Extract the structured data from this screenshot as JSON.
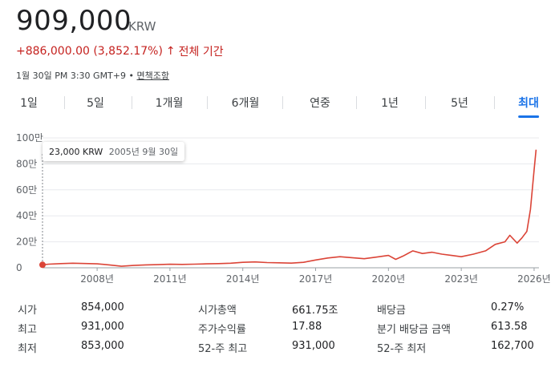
{
  "header": {
    "price": "909,000",
    "currency": "KRW",
    "change": "+886,000.00 (3,852.17%)",
    "change_arrow": "↑",
    "change_period": "전체 기간",
    "timestamp": "1월 30일 PM 3:30 GMT+9 •",
    "disclaimer": "면책조항",
    "accent_color": "#c5221f"
  },
  "tabs": [
    "1일",
    "5일",
    "1개월",
    "6개월",
    "연중",
    "1년",
    "5년",
    "최대"
  ],
  "active_tab": "최대",
  "tooltip": {
    "value": "23,000 KRW",
    "date": "2005년 9월 30일"
  },
  "chart_data": {
    "type": "line",
    "title": "",
    "xlabel": "",
    "ylabel": "",
    "y_tick_labels": [
      "0",
      "20만",
      "40만",
      "60만",
      "80만",
      "100만"
    ],
    "y_ticks": [
      0,
      200000,
      400000,
      600000,
      800000,
      1000000
    ],
    "x_tick_labels": [
      "2008년",
      "2011년",
      "2014년",
      "2017년",
      "2020년",
      "2023년",
      "2026년"
    ],
    "x_ticks": [
      2008,
      2011,
      2014,
      2017,
      2020,
      2023,
      2026
    ],
    "xlim": [
      2005.75,
      2026.2
    ],
    "ylim": [
      0,
      1000000
    ],
    "line_color": "#db4437",
    "series": [
      {
        "x": [
          2005.75,
          2006.0,
          2006.5,
          2007.0,
          2007.5,
          2008.0,
          2008.5,
          2009.0,
          2009.5,
          2010.0,
          2010.5,
          2011.0,
          2011.5,
          2012.0,
          2012.5,
          2013.0,
          2013.5,
          2014.0,
          2014.5,
          2015.0,
          2015.5,
          2016.0,
          2016.5,
          2017.0,
          2017.5,
          2018.0,
          2018.5,
          2019.0,
          2019.5,
          2020.0,
          2020.3,
          2020.6,
          2021.0,
          2021.4,
          2021.8,
          2022.2,
          2022.6,
          2023.0,
          2023.5,
          2024.0,
          2024.4,
          2024.8,
          2025.0,
          2025.3,
          2025.5,
          2025.7,
          2025.85,
          2026.0,
          2026.08
        ],
        "y": [
          23000,
          28000,
          32000,
          35000,
          33000,
          30000,
          22000,
          12000,
          18000,
          22000,
          24000,
          27000,
          26000,
          28000,
          30000,
          32000,
          35000,
          42000,
          45000,
          40000,
          38000,
          36000,
          42000,
          60000,
          75000,
          85000,
          78000,
          70000,
          82000,
          95000,
          65000,
          90000,
          130000,
          110000,
          120000,
          105000,
          95000,
          85000,
          105000,
          130000,
          180000,
          200000,
          250000,
          190000,
          230000,
          280000,
          450000,
          750000,
          909000
        ]
      }
    ]
  },
  "stats": [
    [
      {
        "label": "시가",
        "value": "854,000"
      },
      {
        "label": "시가총액",
        "value": "661.75조"
      },
      {
        "label": "배당금",
        "value": "0.27%"
      }
    ],
    [
      {
        "label": "최고",
        "value": "931,000"
      },
      {
        "label": "주가수익률",
        "value": "17.88"
      },
      {
        "label": "분기 배당금 금액",
        "value": "613.58"
      }
    ],
    [
      {
        "label": "최저",
        "value": "853,000"
      },
      {
        "label": "52-주 최고",
        "value": "931,000"
      },
      {
        "label": "52-주 최저",
        "value": "162,700"
      }
    ]
  ]
}
